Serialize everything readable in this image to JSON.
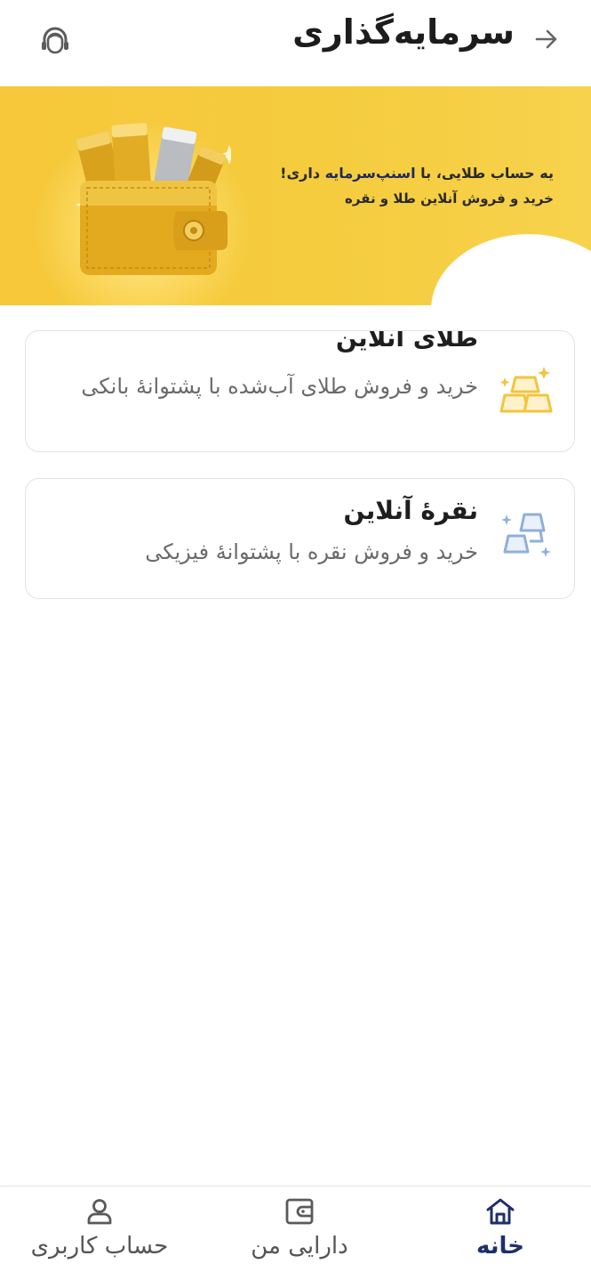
{
  "header": {
    "title": "سرمایه‌گذاری",
    "back_icon": "arrow-right-icon",
    "support_icon": "support-agent-icon"
  },
  "banner": {
    "line1_prefix": "یه حساب طلایی، با ",
    "line1_brand": "اسنپ‌سرمایه",
    "line1_suffix": " داری!",
    "line2": "خرید و فروش آنلاین طلا و نقره",
    "image": "gold-wallet-illustration"
  },
  "cards": [
    {
      "title": "طلای آنلاین",
      "description": "خرید و فروش طلای آب‌شده با پشتوانهٔ بانکی",
      "icon": "gold-bars-icon",
      "icon_color": "#F2C53D"
    },
    {
      "title": "نقرهٔ آنلاین",
      "description": "خرید و فروش نقره با پشتوانهٔ فیزیکی",
      "icon": "silver-bars-icon",
      "icon_color": "#8FB0D8"
    }
  ],
  "bottom_nav": {
    "items": [
      {
        "label": "خانه",
        "icon": "home-icon",
        "active": true
      },
      {
        "label": "دارایی من",
        "icon": "wallet-icon",
        "active": false
      },
      {
        "label": "حساب کاربری",
        "icon": "user-icon",
        "active": false
      }
    ],
    "active_color": "#1F2F6A"
  },
  "colors": {
    "banner": "#F6C83A",
    "card_border": "#E3E3E3"
  }
}
